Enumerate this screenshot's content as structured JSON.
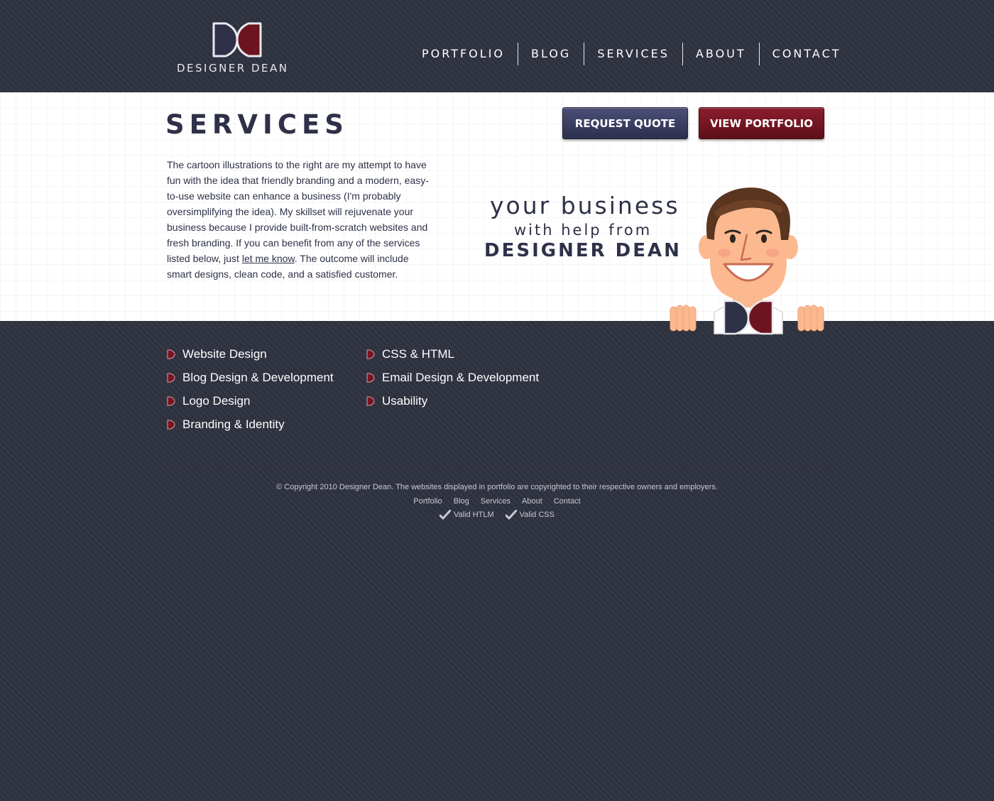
{
  "header": {
    "logo_text": "DESIGNER DEAN",
    "nav": [
      {
        "label": "PORTFOLIO"
      },
      {
        "label": "BLOG"
      },
      {
        "label": "SERVICES"
      },
      {
        "label": "ABOUT"
      },
      {
        "label": "CONTACT"
      }
    ]
  },
  "main": {
    "title": "SERVICES",
    "buttons": {
      "request_quote": "REQUEST QUOTE",
      "view_portfolio": "VIEW PORTFOLIO"
    },
    "intro_before_link": "The cartoon illustrations to the right are my attempt to have fun with the idea that friendly branding and a modern, easy-to-use website can enhance a business (I'm probably oversimplifying the idea). My skillset will rejuvenate your business because I provide built-from-scratch websites and fresh branding. If you can benefit from any of the services listed below, just ",
    "intro_link": "let me know",
    "intro_after_link": ". The outcome will include smart designs, clean code, and a satisfied customer.",
    "tagline": {
      "line1": "your business",
      "line2": "with help from",
      "line3": "DESIGNER DEAN"
    }
  },
  "services": {
    "column1": [
      "Website Design",
      "Blog Design & Development",
      "Logo Design",
      "Branding & Identity"
    ],
    "column2": [
      "CSS & HTML",
      "Email Design & Development",
      "Usability"
    ]
  },
  "footer": {
    "copyright": "© Copyright 2010 Designer Dean. The websites displayed in portfolio are copyrighted to their respective owners and employers.",
    "nav": [
      "Portfolio",
      "Blog",
      "Services",
      "About",
      "Contact"
    ],
    "valid_html": "Valid HTLM",
    "valid_css": "Valid CSS"
  },
  "colors": {
    "navy": "#2e3148",
    "maroon": "#7a1421",
    "background": "#2f323f",
    "skin": "#fcb98f"
  }
}
